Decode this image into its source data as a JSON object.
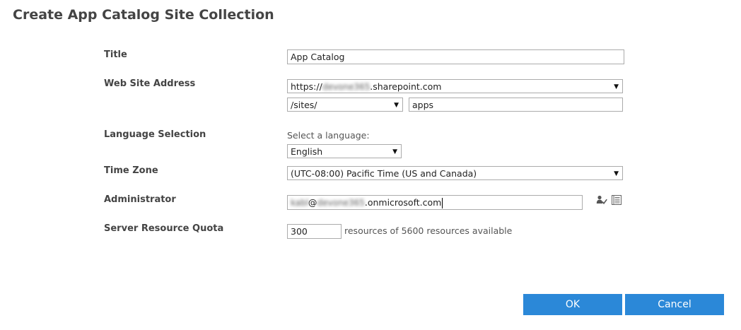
{
  "dialog": {
    "title": "Create App Catalog Site Collection"
  },
  "fields": {
    "title": {
      "label": "Title",
      "value": "App Catalog"
    },
    "web_site_address": {
      "label": "Web Site Address",
      "host_prefix": "https://",
      "host_tenant_blurred": "devone365",
      "host_suffix": ".sharepoint.com",
      "path_select": "/sites/",
      "site_name": "apps"
    },
    "language": {
      "label": "Language Selection",
      "hint": "Select a language:",
      "selected": "English"
    },
    "time_zone": {
      "label": "Time Zone",
      "selected": "(UTC-08:00) Pacific Time (US and Canada)"
    },
    "administrator": {
      "label": "Administrator",
      "user_blurred": "kabl",
      "at": "@",
      "tenant_blurred": "devone365",
      "domain_suffix": ".onmicrosoft.com"
    },
    "quota": {
      "label": "Server Resource Quota",
      "value": "300",
      "suffix": "resources of 5600 resources available"
    }
  },
  "buttons": {
    "ok": "OK",
    "cancel": "Cancel"
  },
  "colors": {
    "button_bg": "#2b88d8",
    "button_text": "#ffffff",
    "border": "#ababab"
  },
  "icons": {
    "check_names": "check-names-icon",
    "browse": "address-book-icon",
    "dropdown": "chevron-down-icon"
  }
}
